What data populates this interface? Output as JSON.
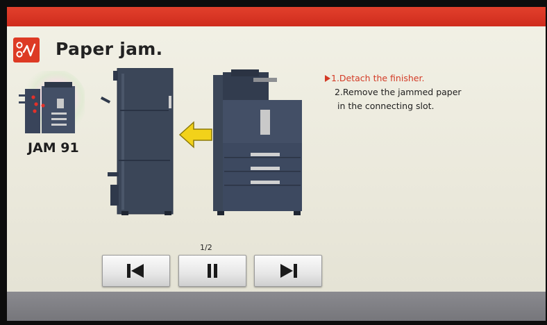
{
  "screen": {
    "title": "Paper jam.",
    "jam_code": "JAM 91",
    "icon": "paper-jam-icon"
  },
  "instructions": {
    "step1": "1.Detach the finisher.",
    "step2_line1": "2.Remove the jammed paper",
    "step2_line2": "in the connecting slot.",
    "current_step": 1
  },
  "player": {
    "page_indicator": "1/2",
    "buttons": [
      {
        "name": "previous",
        "icon": "skip-previous-icon"
      },
      {
        "name": "pause",
        "icon": "pause-icon"
      },
      {
        "name": "next",
        "icon": "skip-next-icon"
      }
    ]
  },
  "colors": {
    "header_red": "#d8362a",
    "step_highlight": "#d33a25",
    "arrow_yellow": "#f2d21a",
    "machine_body": "#3b4658"
  }
}
